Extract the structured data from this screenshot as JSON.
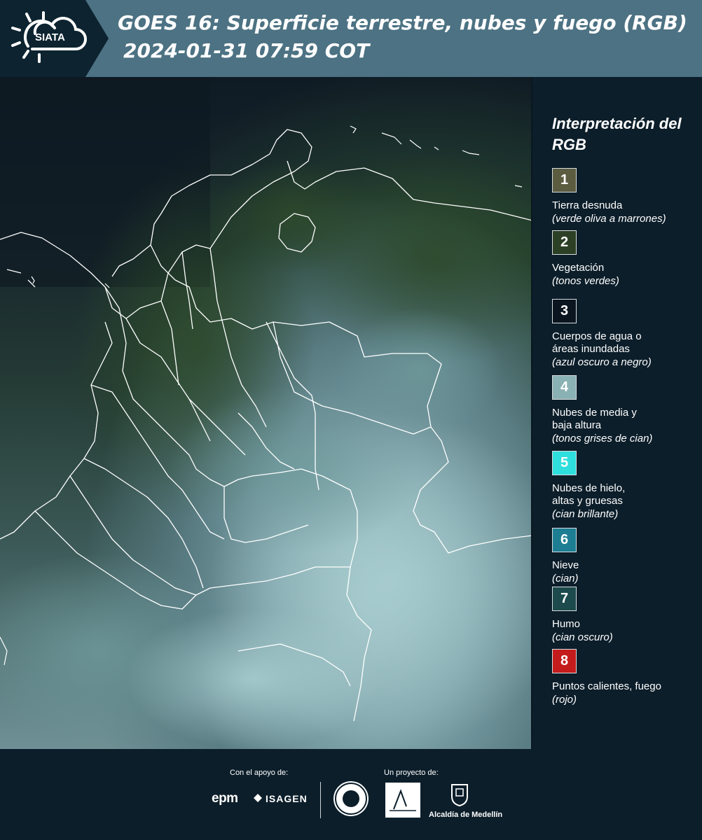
{
  "header": {
    "logo_text": "SIATA",
    "title": "GOES 16: Superficie terrestre, nubes y fuego (RGB)",
    "timestamp": "2024-01-31 07:59 COT"
  },
  "legend": {
    "title": "Interpretación del RGB",
    "items": [
      {
        "number": "1",
        "color": "#5c5c40",
        "name": "Tierra desnuda",
        "desc": "(verde oliva a marrones)"
      },
      {
        "number": "2",
        "color": "#2c4026",
        "name": "Vegetación",
        "desc": "(tonos verdes)"
      },
      {
        "number": "3",
        "color": "#0b1520",
        "name": "Cuerpos de agua o áreas inundadas",
        "desc": "(azul oscuro a negro)"
      },
      {
        "number": "4",
        "color": "#8ab1b3",
        "name": "Nubes de media y baja altura",
        "desc": "(tonos grises de cian)"
      },
      {
        "number": "5",
        "color": "#2fdfdd",
        "name": "Nubes de hielo, altas y gruesas",
        "desc": "(cian brillante)"
      },
      {
        "number": "6",
        "color": "#1d7e93",
        "name": "Nieve",
        "desc": "(cian)"
      },
      {
        "number": "7",
        "color": "#1d4a4c",
        "name": "Humo",
        "desc": "(cian oscuro)"
      },
      {
        "number": "8",
        "color": "#c41c1c",
        "name": "Puntos calientes, fuego",
        "desc": "(rojo)"
      }
    ]
  },
  "footer": {
    "support_label": "Con el apoyo de:",
    "project_label": "Un proyecto de:",
    "sponsor_1": "epm",
    "sponsor_2": "ISAGEN",
    "partner_3": "Alcaldía de Medellín"
  }
}
